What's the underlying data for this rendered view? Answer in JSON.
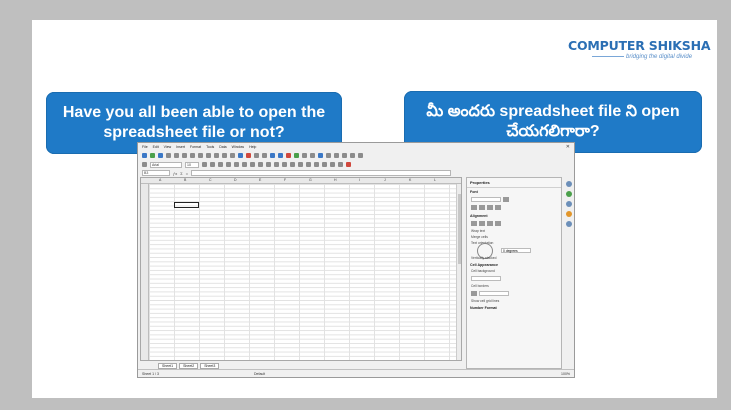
{
  "logo": {
    "text": "COMPUTER SHIKSHA",
    "tagline": "bridging the digital divide"
  },
  "questions": {
    "english": "Have you all been able to open the spreadsheet file or not?",
    "telugu": "మీ అందరు spreadsheet file ని open చేయగలిగారా?"
  },
  "spreadsheet": {
    "menu": [
      "File",
      "Edit",
      "View",
      "Insert",
      "Format",
      "Tools",
      "Data",
      "Window",
      "Help"
    ],
    "font_name": "Arial",
    "font_size": "10",
    "name_box": "B3",
    "columns": [
      "A",
      "B",
      "C",
      "D",
      "E",
      "F",
      "G",
      "H",
      "I",
      "J",
      "K",
      "L"
    ],
    "sheet_tabs": [
      "Sheet1",
      "Sheet2",
      "Sheet3"
    ],
    "status_left": "Sheet 1 / 3",
    "status_mid": "Default",
    "status_right": "100%",
    "sidebar": {
      "title": "Properties",
      "sections": [
        "Font",
        "Alignment",
        "Cell Appearance",
        "Number Format"
      ],
      "labels": [
        "Text orientation",
        "Cell background",
        "Cell borders",
        "Show cell grid lines"
      ],
      "orientation_value": "0 degrees",
      "vertically_stacked": "Vertically stacked",
      "wrap_text": "Wrap text",
      "merge_cells": "Merge cells"
    }
  },
  "colors": {
    "bubble": "#1f7ac7",
    "logo": "#2b6fb4",
    "background": "#bfbfbf"
  }
}
